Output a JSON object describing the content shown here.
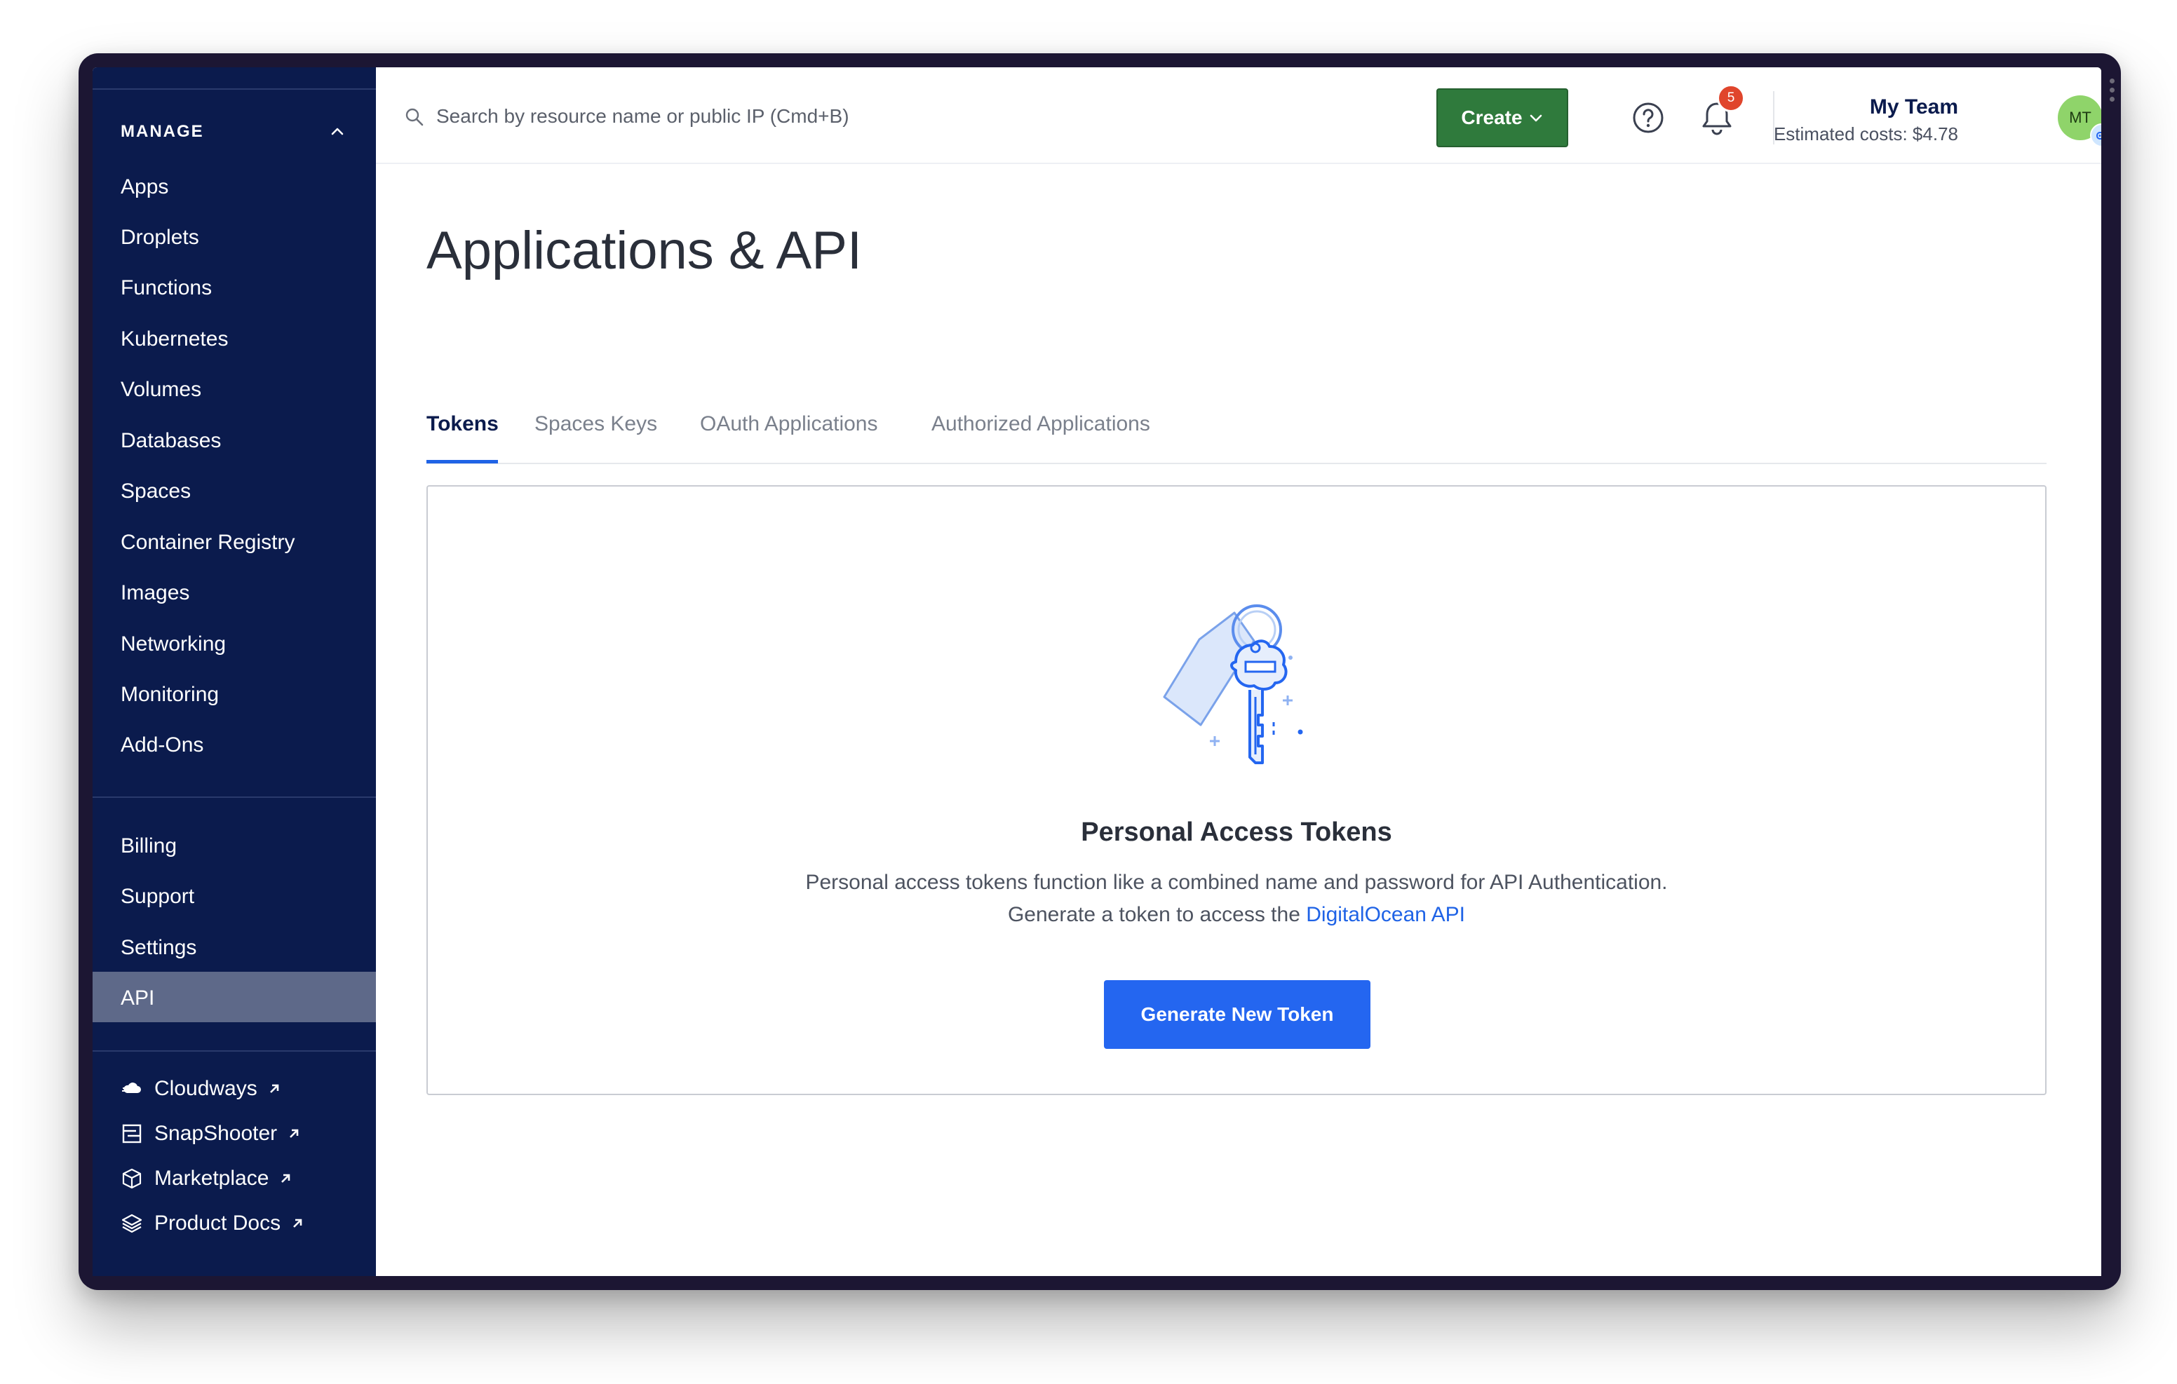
{
  "sidebar": {
    "heading": "MANAGE",
    "items": [
      "Apps",
      "Droplets",
      "Functions",
      "Kubernetes",
      "Volumes",
      "Databases",
      "Spaces",
      "Container Registry",
      "Images",
      "Networking",
      "Monitoring",
      "Add-Ons"
    ],
    "account_items": [
      "Billing",
      "Support",
      "Settings",
      "API"
    ],
    "active_item": "API",
    "external_links": [
      "Cloudways",
      "SnapShooter",
      "Marketplace",
      "Product Docs"
    ]
  },
  "topbar": {
    "search_placeholder": "Search by resource name or public IP (Cmd+B)",
    "create_label": "Create",
    "notification_count": "5",
    "team_name": "My Team",
    "estimated_costs": "Estimated costs: $4.78",
    "avatar_initials": "MT"
  },
  "page": {
    "title": "Applications & API",
    "tabs": [
      "Tokens",
      "Spaces Keys",
      "OAuth Applications",
      "Authorized Applications"
    ],
    "active_tab": "Tokens"
  },
  "empty_state": {
    "title": "Personal Access Tokens",
    "description": "Personal access tokens function like a combined name and password for API Authentication.",
    "generate_prefix": "Generate a token to access the",
    "api_link": "DigitalOcean API",
    "button_label": "Generate New Token"
  },
  "colors": {
    "sidebar_bg": "#0b1b4d",
    "sidebar_active": "#5e6989",
    "create_button": "#2f7a3c",
    "primary_button": "#2466f0",
    "link": "#1f63e6",
    "badge": "#e0452c"
  }
}
